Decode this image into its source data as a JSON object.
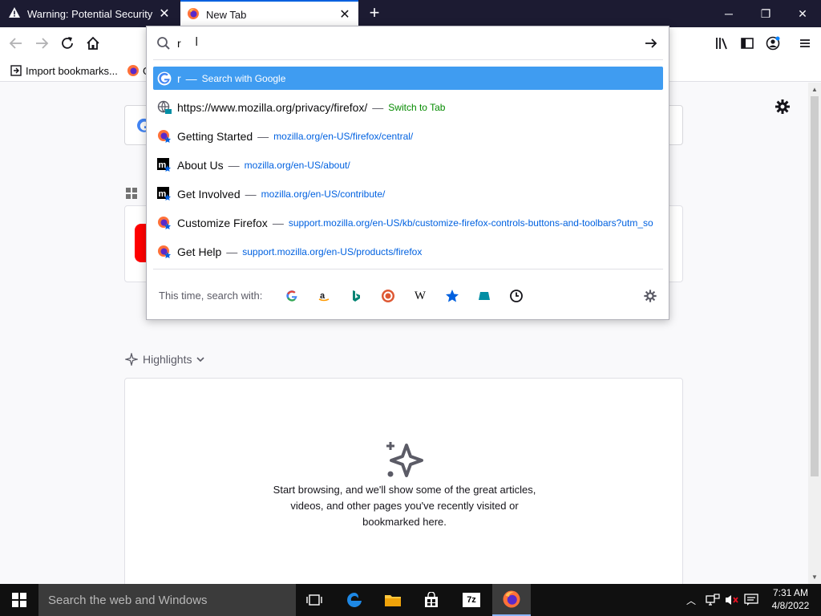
{
  "tabs": [
    {
      "title": "Warning: Potential Security Risk Ahead"
    },
    {
      "title": "New Tab"
    }
  ],
  "window_controls": {
    "minimize": "─",
    "restore": "❐",
    "close": "✕"
  },
  "bookmarks": {
    "import": "Import bookmarks...",
    "second": "G"
  },
  "urlbar": {
    "value": "r",
    "results": [
      {
        "title": "r",
        "detail": "Search with Google",
        "kind": "search",
        "icon": "google-icon"
      },
      {
        "title": "https://www.mozilla.org/privacy/firefox/",
        "detail": "Switch to Tab",
        "kind": "switch-tab",
        "icon": "globe-tab-icon"
      },
      {
        "title": "Getting Started",
        "detail": "mozilla.org/en-US/firefox/central/",
        "kind": "bookmark",
        "icon": "firefox-bookmark-icon"
      },
      {
        "title": "About Us",
        "detail": "mozilla.org/en-US/about/",
        "kind": "bookmark",
        "icon": "mozilla-bookmark-icon"
      },
      {
        "title": "Get Involved",
        "detail": "mozilla.org/en-US/contribute/",
        "kind": "bookmark",
        "icon": "mozilla-bookmark-icon"
      },
      {
        "title": "Customize Firefox",
        "detail": "support.mozilla.org/en-US/kb/customize-firefox-controls-buttons-and-toolbars?utm_so",
        "kind": "bookmark",
        "icon": "firefox-bookmark-icon"
      },
      {
        "title": "Get Help",
        "detail": "support.mozilla.org/en-US/products/firefox",
        "kind": "bookmark",
        "icon": "firefox-bookmark-icon"
      }
    ],
    "oneoff_label": "This time, search with:",
    "oneoff_engines": [
      "google-icon",
      "amazon-icon",
      "bing-icon",
      "duckduckgo-icon",
      "wikipedia-icon",
      "bookmarks-star-icon",
      "tabs-icon",
      "history-clock-icon"
    ]
  },
  "highlights": {
    "label": "Highlights",
    "empty_text_1": "Start browsing, and we'll show some of the great articles,",
    "empty_text_2": "videos, and other pages you've recently visited or",
    "empty_text_3": "bookmarked here."
  },
  "taskbar": {
    "search_placeholder": "Search the web and Windows",
    "time": "7:31 AM",
    "date": "4/8/2022"
  },
  "colors": {
    "accent": "#0060df",
    "selected_row": "#3f9cf1",
    "url_text": "#0061e0",
    "switch_tab_text": "#058b00",
    "tabbar": "#1c1b32"
  }
}
